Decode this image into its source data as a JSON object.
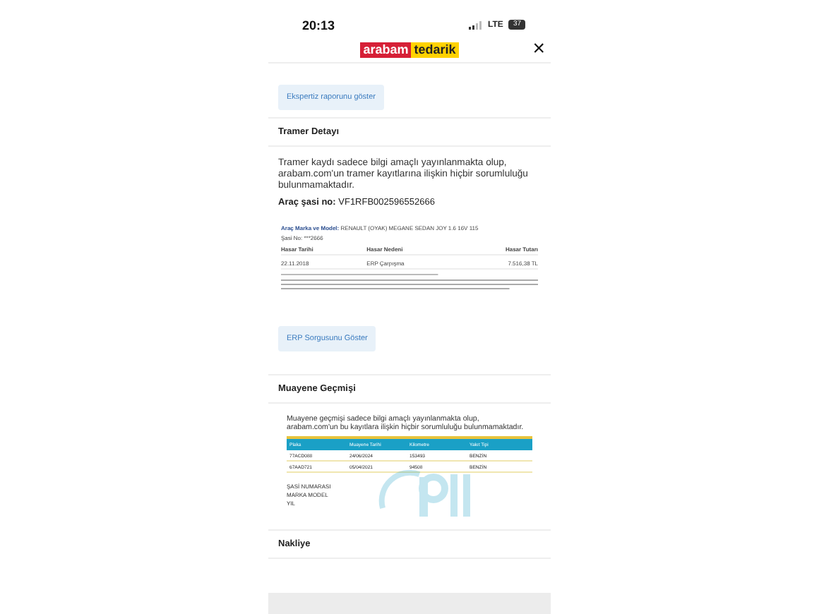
{
  "status_bar": {
    "time": "20:13",
    "network": "LTE",
    "battery": "37"
  },
  "header": {
    "logo_left": "arabam",
    "logo_right": "tedarik",
    "close": "×"
  },
  "expertise_button": "Ekspertiz raporunu göster",
  "tramer": {
    "title": "Tramer Detayı",
    "notice": "Tramer kaydı sadece bilgi amaçlı yayınlanmakta olup, arabam.com'un tramer kayıtlarına ilişkin hiçbir sorumluluğu bulunmamaktadır.",
    "chassis_label": "Araç şasi no:",
    "chassis_value": "VF1RFB002596552666",
    "document": {
      "model_label": "Araç Marka ve Model:",
      "model_value": "RENAULT (OYAK) MEGANE SEDAN JOY 1.6 16V 115",
      "chassis": "Şasi No: ***2666",
      "columns": [
        "Hasar Tarihi",
        "Hasar Nedeni",
        "Hasar Tutarı"
      ],
      "rows": [
        [
          "22.11.2018",
          "ERP Çarpışma",
          "7.516,38 TL"
        ]
      ]
    },
    "erp_button": "ERP Sorgusunu Göster"
  },
  "inspection": {
    "title": "Muayene Geçmişi",
    "document": {
      "notice": "Muayene geçmişi sadece bilgi amaçlı yayınlanmakta olup, arabam.com'un bu kayıtlara ilişkin hiçbir sorumluluğu bulunmamaktadır.",
      "columns": [
        "Plaka",
        "Muayene Tarihi",
        "Kilometre",
        "Yakıt Tipi"
      ],
      "rows": [
        [
          "77ACD088",
          "24/06/2024",
          "153493",
          "BENZİN"
        ],
        [
          "67AAD721",
          "05/04/2021",
          "94508",
          "BENZİN"
        ]
      ],
      "fields": [
        "ŞASİ NUMARASI",
        "MARKA MODEL",
        "YIL"
      ]
    }
  },
  "transport": {
    "title": "Nakliye"
  }
}
